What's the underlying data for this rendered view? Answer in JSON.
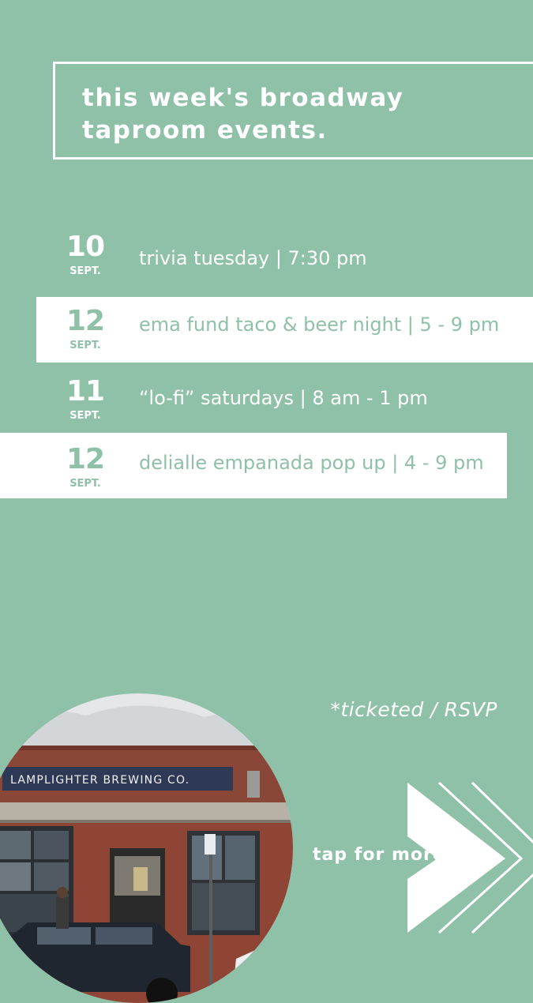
{
  "header": {
    "title_line1": "this week's broadway",
    "title_line2": "taproom events."
  },
  "events": [
    {
      "day": "10",
      "month": "SEPT.",
      "text": "trivia tuesday | 7:30 pm"
    },
    {
      "day": "12",
      "month": "SEPT.",
      "text": "ema fund taco & beer night | 5 - 9 pm"
    },
    {
      "day": "11",
      "month": "SEPT.",
      "text": "“lo-fi” saturdays | 8 am - 1 pm"
    },
    {
      "day": "12",
      "month": "SEPT.",
      "text": "delialle empanada pop up | 4 - 9 pm"
    }
  ],
  "footnote": "*ticketed / RSVP",
  "photo": {
    "sign_text": "LAMPLIGHTER BREWING CO."
  },
  "cta": {
    "label": "tap for more",
    "icon": "chevron-arrows-icon"
  },
  "colors": {
    "background": "#8fc0a8",
    "text_light": "#ffffff",
    "band": "#ffffff"
  }
}
